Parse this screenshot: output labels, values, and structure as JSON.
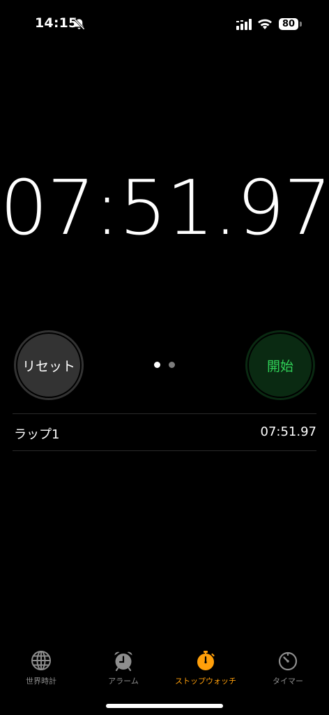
{
  "status_bar": {
    "time": "14:15",
    "battery_level": "80",
    "icons": [
      "bell-slash-icon",
      "cellular-signal-icon",
      "wifi-icon",
      "battery-icon"
    ]
  },
  "stopwatch": {
    "elapsed": "07:51.97"
  },
  "controls": {
    "reset_label": "リセット",
    "start_label": "開始",
    "page_count": 2,
    "active_page": 1
  },
  "laps": [
    {
      "label": "ラップ1",
      "time": "07:51.97"
    }
  ],
  "tab_bar": {
    "tabs": [
      {
        "label": "世界時計",
        "icon": "globe-icon",
        "active": false
      },
      {
        "label": "アラーム",
        "icon": "alarm-clock-icon",
        "active": false
      },
      {
        "label": "ストップウォッチ",
        "icon": "stopwatch-icon",
        "active": true
      },
      {
        "label": "タイマー",
        "icon": "timer-icon",
        "active": false
      }
    ]
  },
  "colors": {
    "background": "#000000",
    "accent": "#ff9f0a",
    "start_text": "#30d158",
    "start_bg": "#0a2a12",
    "reset_bg": "#333333",
    "inactive_tab": "#8e8e8e"
  }
}
